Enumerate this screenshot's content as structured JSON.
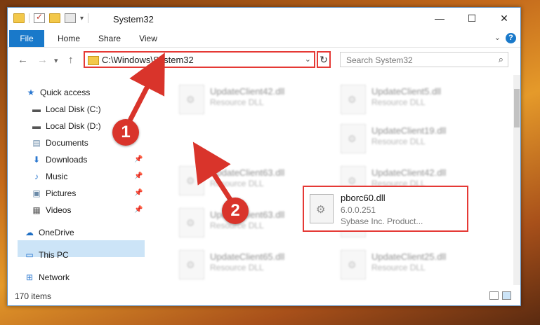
{
  "window": {
    "title": "System32",
    "controls": [
      "—",
      "☐",
      "✕"
    ]
  },
  "ribbon": {
    "tabs": [
      "File",
      "Home",
      "Share",
      "View"
    ],
    "help": "?"
  },
  "nav": {
    "back": "←",
    "forward": "→",
    "recent": "▾",
    "up": "↑",
    "address": "C:\\Windows\\System32",
    "refresh": "↻",
    "search_placeholder": "Search System32"
  },
  "sidebar": {
    "items": [
      {
        "label": "Quick access",
        "icon": "star-icon",
        "glyph": "★",
        "color": "#2b78d0"
      },
      {
        "label": "Local Disk (C:)",
        "icon": "disk-icon",
        "glyph": "▬",
        "color": "#555555"
      },
      {
        "label": "Local Disk (D:)",
        "icon": "disk-icon",
        "glyph": "▬",
        "color": "#555555"
      },
      {
        "label": "Documents",
        "icon": "documents-icon",
        "glyph": "▤",
        "color": "#6a8aa8"
      },
      {
        "label": "Downloads",
        "icon": "downloads-icon",
        "glyph": "⬇",
        "color": "#2b78d0"
      },
      {
        "label": "Music",
        "icon": "music-icon",
        "glyph": "♪",
        "color": "#2b78d0"
      },
      {
        "label": "Pictures",
        "icon": "pictures-icon",
        "glyph": "▣",
        "color": "#6a8aa8"
      },
      {
        "label": "Videos",
        "icon": "videos-icon",
        "glyph": "▦",
        "color": "#555555"
      },
      {
        "label": "OneDrive",
        "icon": "onedrive-icon",
        "glyph": "☁",
        "color": "#1f6fc4"
      },
      {
        "label": "This PC",
        "icon": "computer-icon",
        "glyph": "▭",
        "color": "#2b78d0"
      },
      {
        "label": "Network",
        "icon": "network-icon",
        "glyph": "⊞",
        "color": "#2b78d0"
      }
    ]
  },
  "files": {
    "background": [
      {
        "name": "UpdateClient42.dll",
        "sub": "Resource DLL"
      },
      {
        "name": "UpdateClient5.dll",
        "sub": "Resource DLL"
      },
      {
        "name": "UpdateClient19.dll",
        "sub": "Resource DLL"
      },
      {
        "name": "UpdateClient63.dll",
        "sub": "Resource DLL"
      },
      {
        "name": "UpdateClient42.dll",
        "sub": "Resource DLL"
      },
      {
        "name": "UpdateClient63.dll",
        "sub": "Resource DLL"
      },
      {
        "name": "UpdateClient5.dll",
        "sub": "Resource DLL"
      },
      {
        "name": "UpdateClient65.dll",
        "sub": "Resource DLL"
      },
      {
        "name": "UpdateClient25.dll",
        "sub": "Resource DLL"
      }
    ],
    "selected": {
      "name": "pborc60.dll",
      "version": "6.0.0.251",
      "company": "Sybase Inc. Product..."
    }
  },
  "status": {
    "count": "170 items"
  },
  "callouts": {
    "one": "1",
    "two": "2",
    "color": "#d9342b"
  }
}
